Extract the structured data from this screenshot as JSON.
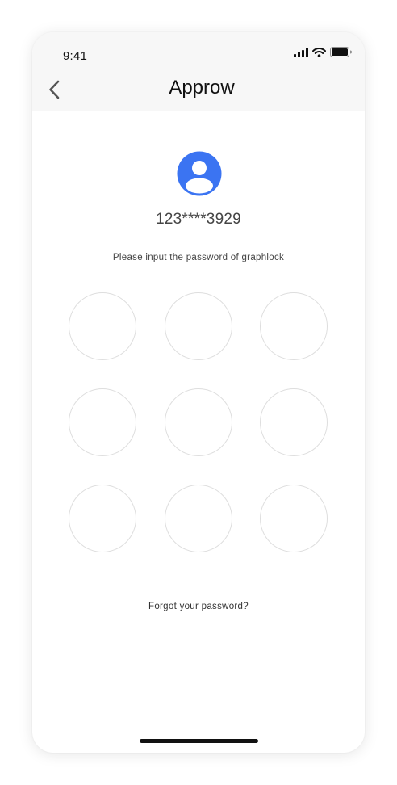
{
  "status_bar": {
    "time": "9:41"
  },
  "nav": {
    "title": "Approw"
  },
  "user": {
    "account": "123****3929"
  },
  "lock": {
    "instruction": "Please input the password of graphlock",
    "forgot_label": "Forgot your password?"
  },
  "colors": {
    "accent": "#3b74f2",
    "dot_border": "#dedede",
    "header_bg": "#f7f7f7"
  }
}
